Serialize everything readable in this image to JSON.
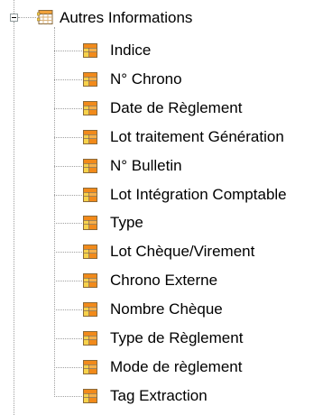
{
  "tree": {
    "parent": {
      "label": "Autres Informations",
      "icon": "table-grid-icon",
      "expanded": true
    },
    "items": [
      {
        "label": "Indice",
        "icon": "field-icon"
      },
      {
        "label": "N° Chrono",
        "icon": "field-icon"
      },
      {
        "label": "Date de Règlement",
        "icon": "field-icon"
      },
      {
        "label": "Lot traitement Génération",
        "icon": "field-icon"
      },
      {
        "label": "N° Bulletin",
        "icon": "field-icon"
      },
      {
        "label": "Lot Intégration Comptable",
        "icon": "field-icon"
      },
      {
        "label": "Type",
        "icon": "field-icon"
      },
      {
        "label": "Lot Chèque/Virement",
        "icon": "field-icon"
      },
      {
        "label": "Chrono Externe",
        "icon": "field-icon"
      },
      {
        "label": "Nombre Chèque",
        "icon": "field-icon"
      },
      {
        "label": "Type de Règlement",
        "icon": "field-icon"
      },
      {
        "label": "Mode de règlement",
        "icon": "field-icon"
      },
      {
        "label": "Tag Extraction",
        "icon": "field-icon"
      }
    ]
  },
  "colors": {
    "connector": "#a0a0a0",
    "icon_orange": "#f28a1a",
    "icon_yellow": "#f7d24a",
    "icon_border": "#8a6a3a"
  }
}
